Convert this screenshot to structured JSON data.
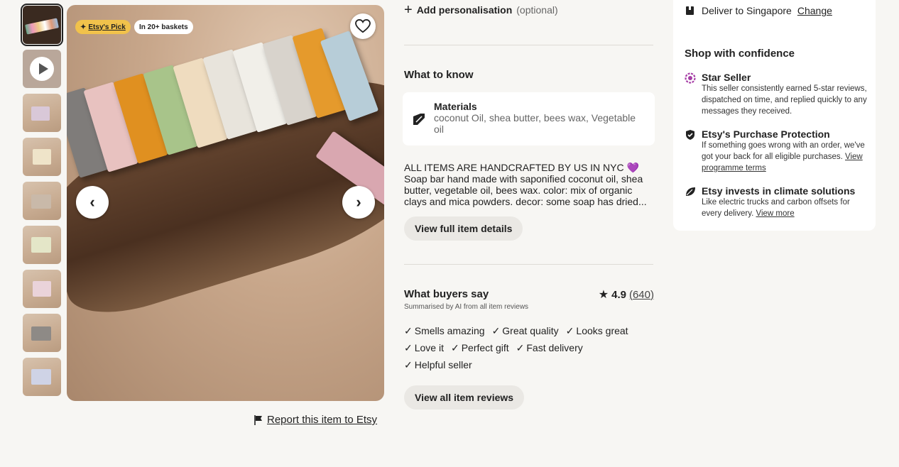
{
  "gallery": {
    "thumbnails": [
      {
        "kind": "image",
        "label": "thumbnail-1"
      },
      {
        "kind": "video",
        "label": "thumbnail-video"
      },
      {
        "kind": "image",
        "label": "thumbnail-3"
      },
      {
        "kind": "image",
        "label": "thumbnail-4"
      },
      {
        "kind": "image",
        "label": "thumbnail-5"
      },
      {
        "kind": "image",
        "label": "thumbnail-6"
      },
      {
        "kind": "image",
        "label": "thumbnail-7"
      },
      {
        "kind": "image",
        "label": "thumbnail-8"
      },
      {
        "kind": "image",
        "label": "thumbnail-9"
      }
    ],
    "badges": {
      "etsys_pick": "Etsy's Pick",
      "baskets": "In 20+ baskets"
    },
    "report_link": "Report this item to Etsy"
  },
  "personalisation": {
    "label": "Add personalisation",
    "optional": "(optional)"
  },
  "what_to_know": {
    "heading": "What to know",
    "materials_title": "Materials",
    "materials_value": "coconut Oil, shea butter, bees wax, Vegetable oil"
  },
  "description": {
    "line1": "ALL ITEMS ARE HANDCRAFTED BY US IN NYC 💜",
    "body": "Soap bar hand made with saponified coconut oil, shea butter, vegetable oil, bees wax. color: mix of organic clays and mica powders. decor: some soap has dried...",
    "full_details_button": "View full item details"
  },
  "reviews": {
    "heading": "What buyers say",
    "subheading": "Summarised by AI from all item reviews",
    "rating": "4.9",
    "count": "(640)",
    "highlights": [
      "Smells amazing",
      "Great quality",
      "Looks great",
      "Love it",
      "Perfect gift",
      "Fast delivery",
      "Helpful seller"
    ],
    "view_all_button": "View all item reviews"
  },
  "sidebar": {
    "deliver_label": "Deliver to Singapore",
    "deliver_change": "Change",
    "confidence_heading": "Shop with confidence",
    "items": [
      {
        "title": "Star Seller",
        "desc": "This seller consistently earned 5-star reviews, dispatched on time, and replied quickly to any messages they received."
      },
      {
        "title": "Etsy's Purchase Protection",
        "desc": "If something goes wrong with an order, we've got your back for all eligible purchases.",
        "link": "View programme terms"
      },
      {
        "title": "Etsy invests in climate solutions",
        "desc": "Like electric trucks and carbon offsets for every delivery.",
        "link": "View more"
      }
    ]
  },
  "colors": {
    "badge_yellow": "#f1c24b",
    "star_seller_purple": "#a63ea6",
    "pill_bg": "#eae8e4",
    "page_bg": "#f7f6f3"
  }
}
